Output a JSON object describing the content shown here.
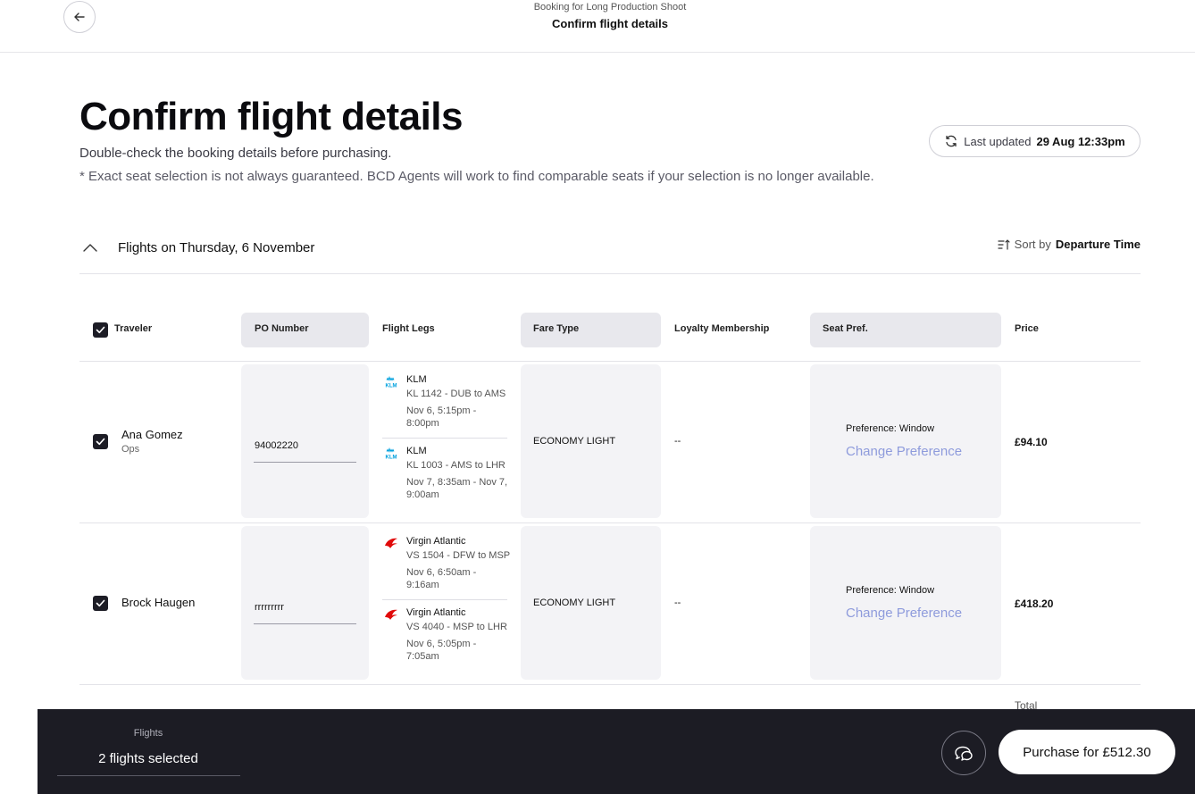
{
  "topbar": {
    "subtitle": "Booking for Long Production Shoot",
    "title": "Confirm flight details"
  },
  "header": {
    "title": "Confirm flight details",
    "subtitle": "Double-check the booking details before purchasing.",
    "note": "* Exact seat selection is not always guaranteed. BCD Agents will work to find comparable seats if your selection is no longer available.",
    "last_updated_label": "Last updated",
    "last_updated_value": "29 Aug 12:33pm"
  },
  "group": {
    "title": "Flights on Thursday, 6 November",
    "sort_label": "Sort by",
    "sort_value": "Departure Time"
  },
  "table": {
    "headers": {
      "traveler": "Traveler",
      "po_number": "PO Number",
      "flight_legs": "Flight Legs",
      "fare_type": "Fare Type",
      "loyalty": "Loyalty Membership",
      "seat_pref": "Seat Pref.",
      "price": "Price"
    },
    "rows": [
      {
        "checked": true,
        "name": "Ana Gomez",
        "role": "Ops",
        "po_number": "94002220",
        "legs": [
          {
            "airline": "KLM",
            "route": "KL 1142 - DUB to AMS",
            "times": "Nov 6, 5:15pm - 8:00pm",
            "logo": "klm-logo"
          },
          {
            "airline": "KLM",
            "route": "KL 1003 - AMS to LHR",
            "times": "Nov 7, 8:35am - Nov 7, 9:00am",
            "logo": "klm-logo"
          }
        ],
        "fare_type": "ECONOMY LIGHT",
        "loyalty": "--",
        "preference": "Preference: Window",
        "change_pref": "Change Preference",
        "price": "£94.10"
      },
      {
        "checked": true,
        "name": "Brock Haugen",
        "role": "",
        "po_number": "rrrrrrrrr",
        "legs": [
          {
            "airline": "Virgin Atlantic",
            "route": "VS 1504 - DFW to MSP",
            "times": "Nov 6, 6:50am - 9:16am",
            "logo": "virgin-atlantic-logo"
          },
          {
            "airline": "Virgin Atlantic",
            "route": "VS 4040 - MSP to LHR",
            "times": "Nov 6, 5:05pm - 7:05am",
            "logo": "virgin-atlantic-logo"
          }
        ],
        "fare_type": "ECONOMY LIGHT",
        "loyalty": "--",
        "preference": "Preference: Window",
        "change_pref": "Change Preference",
        "price": "£418.20"
      }
    ],
    "total_label": "Total"
  },
  "bottombar": {
    "label": "Flights",
    "value": "2 flights selected",
    "purchase_label": "Purchase for £512.30"
  },
  "colors": {
    "accent_link": "#8e9bdc",
    "dark_bar": "#1c1c24",
    "klm_blue": "#00a1de",
    "virgin_red": "#e10a0a"
  }
}
